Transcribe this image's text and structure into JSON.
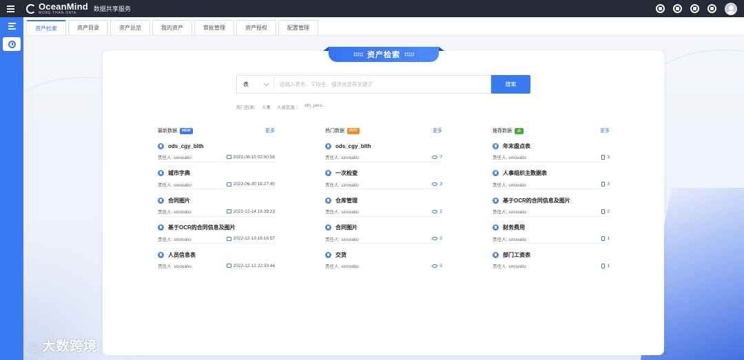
{
  "header": {
    "logo_name": "OceanMind",
    "logo_tagline": "MORE THAN DATA",
    "app_title": "数据共享服务"
  },
  "tabs": [
    {
      "label": "资产检索",
      "active": true
    },
    {
      "label": "资产目录",
      "active": false
    },
    {
      "label": "资产总览",
      "active": false
    },
    {
      "label": "我的资产",
      "active": false
    },
    {
      "label": "审批管理",
      "active": false
    },
    {
      "label": "资产授权",
      "active": false
    },
    {
      "label": "配置管理",
      "active": false
    }
  ],
  "panel": {
    "title": "资产检索"
  },
  "search": {
    "type_value": "表",
    "placeholder": "请输入表名、字段名、描述信息等关键字",
    "button": "搜索"
  },
  "hot_search": {
    "label": "热门检索:",
    "words": [
      "人事",
      "人员信息...",
      "dm_pers..."
    ]
  },
  "columns": [
    {
      "title": "最新数据",
      "badge": "NEW",
      "badge_color": "#3a7af0",
      "more": "更多",
      "meta_icon": "calendar-icon",
      "items": [
        {
          "name": "ods_cgy_blth",
          "owner_label": "责任人:",
          "owner": "sinovatio",
          "value": "2023-08-10 02:00:56"
        },
        {
          "name": "城市字典",
          "owner_label": "责任人:",
          "owner": "sinovatio",
          "value": "2023-06-30 16:27:40"
        },
        {
          "name": "合同图片",
          "owner_label": "责任人:",
          "owner": "sinovatio",
          "value": "2022-12-14 16:39:23"
        },
        {
          "name": "基于OCR的合同信息及图片",
          "owner_label": "责任人:",
          "owner": "sinovatio",
          "value": "2022-12-13 16:18:57"
        },
        {
          "name": "人员信息表",
          "owner_label": "责任人:",
          "owner": "sinovatio",
          "value": "2022-12-12 22:33:44"
        }
      ]
    },
    {
      "title": "热门数据",
      "badge": "HOT",
      "badge_color": "#f08a24",
      "more": "更多",
      "meta_icon": "eye-icon",
      "items": [
        {
          "name": "ods_cgy_blth",
          "owner_label": "责任人:",
          "owner": "sinovatio",
          "value": "7"
        },
        {
          "name": "一次检查",
          "owner_label": "责任人:",
          "owner": "sinovatio",
          "value": "3"
        },
        {
          "name": "仓库管理",
          "owner_label": "责任人:",
          "owner": "sinovatio",
          "value": "2"
        },
        {
          "name": "合同图片",
          "owner_label": "责任人:",
          "owner": "sinovatio",
          "value": "2"
        },
        {
          "name": "交货",
          "owner_label": "责任人:",
          "owner": "sinovatio",
          "value": "2"
        }
      ]
    },
    {
      "title": "推荐数据",
      "badge": "👍",
      "badge_color": "#2fb355",
      "more": "更多",
      "meta_icon": "document-icon",
      "items": [
        {
          "name": "年末盘点表",
          "owner_label": "责任人:",
          "owner": "sinovatio",
          "value": "3"
        },
        {
          "name": "人事组织主数据表",
          "owner_label": "责任人:",
          "owner": "sinovatio",
          "value": "3"
        },
        {
          "name": "基于OCR的合同信息及图片",
          "owner_label": "责任人:",
          "owner": "sinovatio",
          "value": "2"
        },
        {
          "name": "财务费用",
          "owner_label": "责任人:",
          "owner": "sinovatio",
          "value": "1"
        },
        {
          "name": "部门工资表",
          "owner_label": "责任人:",
          "owner": "sinovatio",
          "value": "1"
        }
      ]
    }
  ],
  "watermark": {
    "logo": "☺",
    "text": "大数跨境"
  },
  "colors": {
    "accent": "#3a7af0",
    "topbar": "#262a36"
  }
}
